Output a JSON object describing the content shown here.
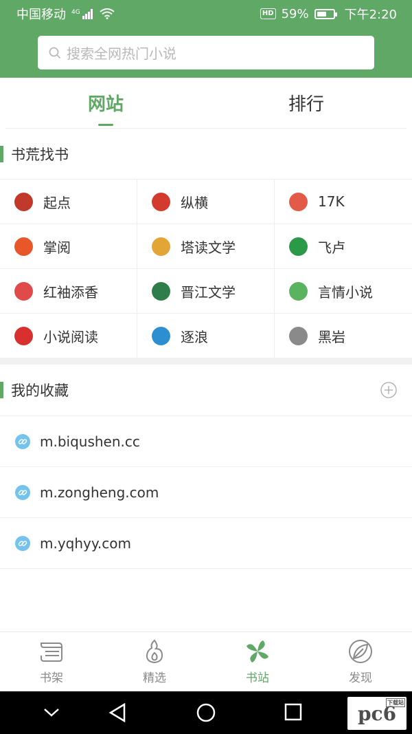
{
  "status_bar": {
    "carrier": "中国移动",
    "network": "4G",
    "battery_percent": "59%",
    "battery_level": 0.59,
    "hd_label": "HD",
    "time": "下午2:20"
  },
  "search": {
    "placeholder": "搜索全网热门小说"
  },
  "top_tabs": [
    {
      "label": "网站",
      "active": true
    },
    {
      "label": "排行",
      "active": false
    }
  ],
  "sections": {
    "find_books": {
      "title": "书荒找书"
    },
    "favorites": {
      "title": "我的收藏"
    }
  },
  "sites": [
    {
      "name": "起点",
      "logo": "qidian-logo",
      "color": "#c0392b"
    },
    {
      "name": "纵横",
      "logo": "zongheng-logo",
      "color": "#d43b2f"
    },
    {
      "name": "17K",
      "logo": "17k-logo",
      "color": "#e35b48"
    },
    {
      "name": "掌阅",
      "logo": "zhangyue-logo",
      "color": "#e8572a"
    },
    {
      "name": "塔读文学",
      "logo": "tadu-logo",
      "color": "#e3a536"
    },
    {
      "name": "飞卢",
      "logo": "feilu-logo",
      "color": "#2a9a48"
    },
    {
      "name": "红袖添香",
      "logo": "hongxiu-logo",
      "color": "#e04a4a"
    },
    {
      "name": "晋江文学",
      "logo": "jinjiang-logo",
      "color": "#2f7d4a"
    },
    {
      "name": "言情小说",
      "logo": "yanqing-logo",
      "color": "#59b35f"
    },
    {
      "name": "小说阅读",
      "logo": "readnovel-logo",
      "color": "#d82f2f"
    },
    {
      "name": "逐浪",
      "logo": "zhulang-logo",
      "color": "#2d8fd0"
    },
    {
      "name": "黑岩",
      "logo": "heiyan-logo",
      "color": "#8a8a8a"
    }
  ],
  "favorites": [
    {
      "url": "m.biqushen.cc"
    },
    {
      "url": "m.zongheng.com"
    },
    {
      "url": "m.yqhyy.com"
    }
  ],
  "bottom_nav": [
    {
      "label": "书架",
      "icon": "bookshelf-icon",
      "active": false
    },
    {
      "label": "精选",
      "icon": "flame-icon",
      "active": false
    },
    {
      "label": "书站",
      "icon": "pinwheel-icon",
      "active": true
    },
    {
      "label": "发现",
      "icon": "leaf-icon",
      "active": false
    }
  ],
  "watermark": {
    "text": "pc6",
    "tag": "下载站"
  },
  "colors": {
    "accent": "#5fa865",
    "link_icon": "#74c3ee",
    "divider": "#eeeeee"
  }
}
